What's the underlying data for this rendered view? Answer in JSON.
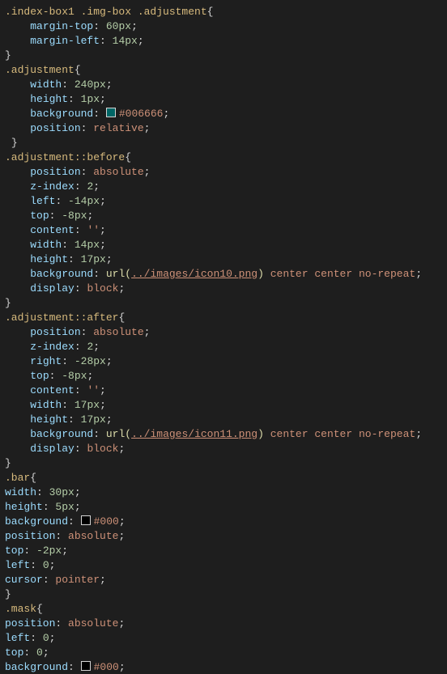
{
  "rules": [
    {
      "selector": ".index-box1 .img-box .adjustment",
      "indentSel": 0,
      "indentProp": 1,
      "closeIndent": 0,
      "props": [
        {
          "name": "margin-top",
          "parts": [
            {
              "t": "num",
              "v": "60px"
            }
          ]
        },
        {
          "name": "margin-left",
          "parts": [
            {
              "t": "num",
              "v": "14px"
            }
          ]
        }
      ]
    },
    {
      "selector": ".adjustment",
      "indentSel": 0,
      "indentProp": 1,
      "closeIndent": 0,
      "closeExtraSpace": true,
      "props": [
        {
          "name": "width",
          "parts": [
            {
              "t": "num",
              "v": "240px"
            }
          ]
        },
        {
          "name": "height",
          "parts": [
            {
              "t": "num",
              "v": "1px"
            }
          ]
        },
        {
          "name": "background",
          "parts": [
            {
              "t": "color",
              "v": "#006666"
            }
          ]
        },
        {
          "name": "position",
          "parts": [
            {
              "t": "kw",
              "v": "relative"
            }
          ]
        }
      ]
    },
    {
      "selector": ".adjustment::before",
      "indentSel": 0,
      "indentProp": 1,
      "closeIndent": 0,
      "props": [
        {
          "name": "position",
          "parts": [
            {
              "t": "kw",
              "v": "absolute"
            }
          ]
        },
        {
          "name": "z-index",
          "parts": [
            {
              "t": "num",
              "v": "2"
            }
          ]
        },
        {
          "name": "left",
          "parts": [
            {
              "t": "num",
              "v": "-14px"
            }
          ]
        },
        {
          "name": "top",
          "parts": [
            {
              "t": "num",
              "v": "-8px"
            }
          ]
        },
        {
          "name": "content",
          "parts": [
            {
              "t": "str",
              "v": "''"
            }
          ]
        },
        {
          "name": "width",
          "parts": [
            {
              "t": "num",
              "v": "14px"
            }
          ]
        },
        {
          "name": "height",
          "parts": [
            {
              "t": "num",
              "v": "17px"
            }
          ]
        },
        {
          "name": "background",
          "parts": [
            {
              "t": "fn",
              "v": "url("
            },
            {
              "t": "url",
              "v": "../images/icon10.png"
            },
            {
              "t": "fn",
              "v": ")"
            },
            {
              "t": "sp"
            },
            {
              "t": "kw",
              "v": "center"
            },
            {
              "t": "sp"
            },
            {
              "t": "kw",
              "v": "center"
            },
            {
              "t": "sp"
            },
            {
              "t": "kw",
              "v": "no-repeat"
            }
          ]
        },
        {
          "name": "display",
          "parts": [
            {
              "t": "kw",
              "v": "block"
            }
          ]
        }
      ]
    },
    {
      "selector": ".adjustment::after",
      "indentSel": 0,
      "indentProp": 1,
      "closeIndent": 0,
      "props": [
        {
          "name": "position",
          "parts": [
            {
              "t": "kw",
              "v": "absolute"
            }
          ]
        },
        {
          "name": "z-index",
          "parts": [
            {
              "t": "num",
              "v": "2"
            }
          ]
        },
        {
          "name": "right",
          "parts": [
            {
              "t": "num",
              "v": "-28px"
            }
          ]
        },
        {
          "name": "top",
          "parts": [
            {
              "t": "num",
              "v": "-8px"
            }
          ]
        },
        {
          "name": "content",
          "parts": [
            {
              "t": "str",
              "v": "''"
            }
          ]
        },
        {
          "name": "width",
          "parts": [
            {
              "t": "num",
              "v": "17px"
            }
          ]
        },
        {
          "name": "height",
          "parts": [
            {
              "t": "num",
              "v": "17px"
            }
          ]
        },
        {
          "name": "background",
          "parts": [
            {
              "t": "fn",
              "v": "url("
            },
            {
              "t": "url",
              "v": "../images/icon11.png"
            },
            {
              "t": "fn",
              "v": ")"
            },
            {
              "t": "sp"
            },
            {
              "t": "kw",
              "v": "center"
            },
            {
              "t": "sp"
            },
            {
              "t": "kw",
              "v": "center"
            },
            {
              "t": "sp"
            },
            {
              "t": "kw",
              "v": "no-repeat"
            }
          ]
        },
        {
          "name": "display",
          "parts": [
            {
              "t": "kw",
              "v": "block"
            }
          ]
        }
      ]
    },
    {
      "selector": ".bar",
      "indentSel": 0,
      "indentProp": 0,
      "closeIndent": 0,
      "props": [
        {
          "name": "width",
          "parts": [
            {
              "t": "num",
              "v": "30px"
            }
          ]
        },
        {
          "name": "height",
          "parts": [
            {
              "t": "num",
              "v": "5px"
            }
          ]
        },
        {
          "name": "background",
          "parts": [
            {
              "t": "color",
              "v": "#000"
            }
          ]
        },
        {
          "name": "position",
          "parts": [
            {
              "t": "kw",
              "v": "absolute"
            }
          ]
        },
        {
          "name": "top",
          "parts": [
            {
              "t": "num",
              "v": "-2px"
            }
          ]
        },
        {
          "name": "left",
          "parts": [
            {
              "t": "num",
              "v": "0"
            }
          ]
        },
        {
          "name": "cursor",
          "parts": [
            {
              "t": "kw",
              "v": "pointer"
            }
          ]
        }
      ]
    },
    {
      "selector": ".mask",
      "indentSel": 0,
      "indentProp": 0,
      "closeIndent": 0,
      "noClose": true,
      "props": [
        {
          "name": "position",
          "parts": [
            {
              "t": "kw",
              "v": "absolute"
            }
          ]
        },
        {
          "name": "left",
          "parts": [
            {
              "t": "num",
              "v": "0"
            }
          ]
        },
        {
          "name": "top",
          "parts": [
            {
              "t": "num",
              "v": "0"
            }
          ]
        },
        {
          "name": "background",
          "parts": [
            {
              "t": "color",
              "v": "#000"
            }
          ]
        }
      ]
    }
  ],
  "indentUnit": "    "
}
